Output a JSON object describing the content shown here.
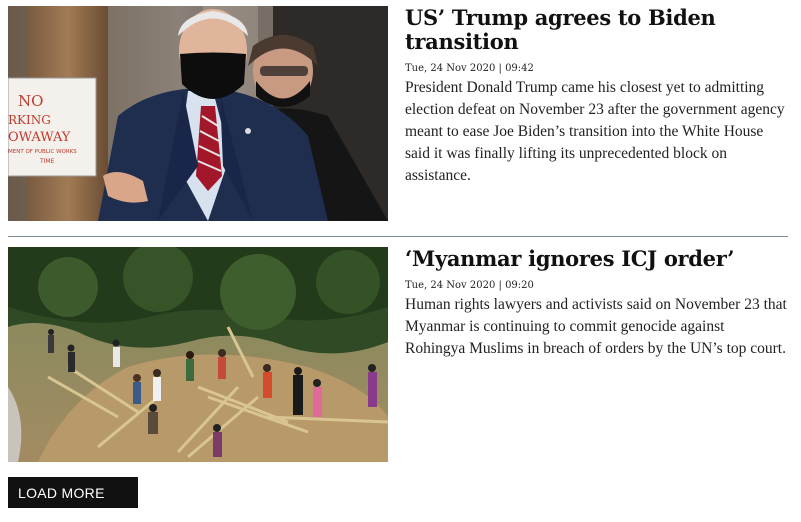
{
  "articles": [
    {
      "headline": "US’ Trump agrees to Biden transition",
      "dateline": "Tue, 24 Nov 2020 | 09:42",
      "summary": "President Donald Trump came his closest yet to admitting election defeat on November 23 after the government agency meant to ease Joe Biden’s transition into the White House said it was finally lifting its unprecedented block on assistance.",
      "image_sign_lines": [
        "NO",
        "RKING",
        "OWAWAY",
        "MENT OF PUBLIC WORKS",
        "TIME"
      ]
    },
    {
      "headline": "‘Myanmar ignores ICJ order’",
      "dateline": "Tue, 24 Nov 2020 | 09:20",
      "summary": "Human rights lawyers and activists said on November 23 that Myanmar is continuing to commit genocide against Rohingya Muslims in breach of orders by the UN’s top court."
    }
  ],
  "load_more_label": "LOAD MORE",
  "colors": {
    "divider": "#7a8a99",
    "button_bg": "#111111",
    "button_text": "#ffffff",
    "sign_red": "#c0392b"
  }
}
